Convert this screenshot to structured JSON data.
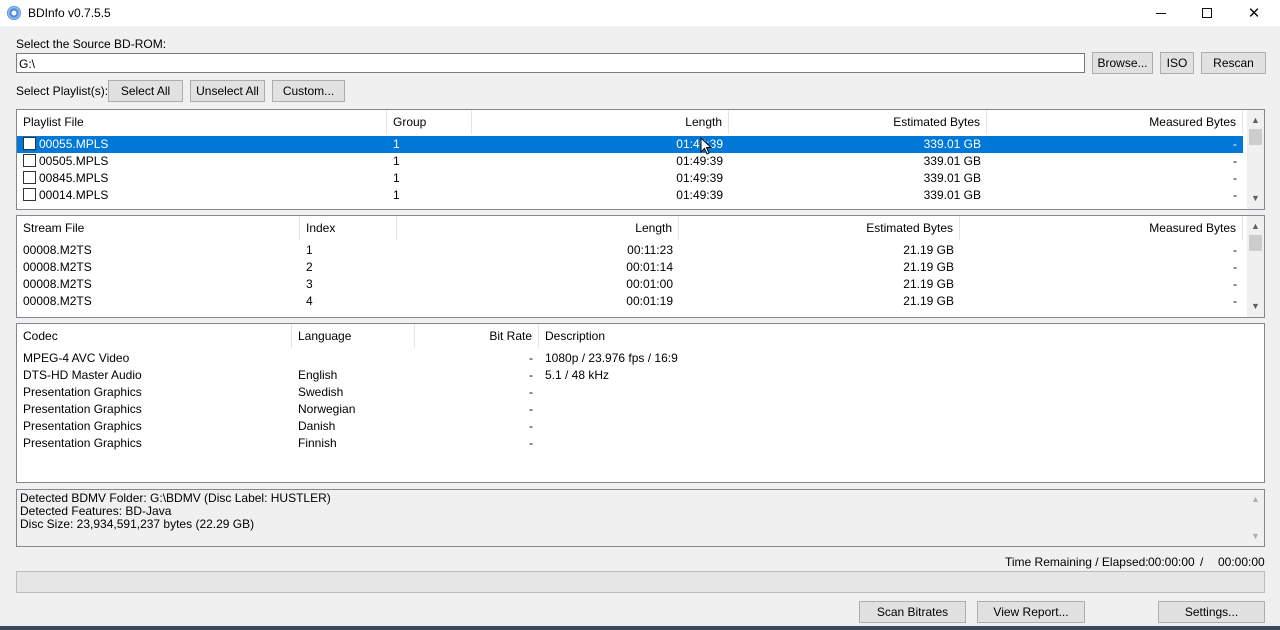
{
  "window": {
    "title": "BDInfo v0.7.5.5"
  },
  "source": {
    "label": "Select the Source BD-ROM:",
    "path": "G:\\",
    "browse": "Browse...",
    "iso": "ISO",
    "rescan": "Rescan"
  },
  "playlist_controls": {
    "label": "Select Playlist(s):",
    "select_all": "Select All",
    "unselect_all": "Unselect All",
    "custom": "Custom..."
  },
  "playlists": {
    "columns": [
      "Playlist File",
      "Group",
      "Length",
      "Estimated Bytes",
      "Measured Bytes"
    ],
    "rows": [
      {
        "file": "00055.MPLS",
        "group": "1",
        "length": "01:49:39",
        "est": "339.01 GB",
        "meas": "-"
      },
      {
        "file": "00505.MPLS",
        "group": "1",
        "length": "01:49:39",
        "est": "339.01 GB",
        "meas": "-"
      },
      {
        "file": "00845.MPLS",
        "group": "1",
        "length": "01:49:39",
        "est": "339.01 GB",
        "meas": "-"
      },
      {
        "file": "00014.MPLS",
        "group": "1",
        "length": "01:49:39",
        "est": "339.01 GB",
        "meas": "-"
      }
    ]
  },
  "streams": {
    "columns": [
      "Stream File",
      "Index",
      "Length",
      "Estimated Bytes",
      "Measured Bytes"
    ],
    "rows": [
      {
        "file": "00008.M2TS",
        "index": "1",
        "length": "00:11:23",
        "est": "21.19 GB",
        "meas": "-"
      },
      {
        "file": "00008.M2TS",
        "index": "2",
        "length": "00:01:14",
        "est": "21.19 GB",
        "meas": "-"
      },
      {
        "file": "00008.M2TS",
        "index": "3",
        "length": "00:01:00",
        "est": "21.19 GB",
        "meas": "-"
      },
      {
        "file": "00008.M2TS",
        "index": "4",
        "length": "00:01:19",
        "est": "21.19 GB",
        "meas": "-"
      }
    ]
  },
  "codecs": {
    "columns": [
      "Codec",
      "Language",
      "Bit Rate",
      "Description"
    ],
    "rows": [
      {
        "codec": "MPEG-4 AVC Video",
        "lang": "",
        "bitrate": "-",
        "desc": "1080p / 23.976 fps / 16:9"
      },
      {
        "codec": "DTS-HD Master Audio",
        "lang": "English",
        "bitrate": "-",
        "desc": "5.1 / 48 kHz"
      },
      {
        "codec": "Presentation Graphics",
        "lang": "Swedish",
        "bitrate": "-",
        "desc": ""
      },
      {
        "codec": "Presentation Graphics",
        "lang": "Norwegian",
        "bitrate": "-",
        "desc": ""
      },
      {
        "codec": "Presentation Graphics",
        "lang": "Danish",
        "bitrate": "-",
        "desc": ""
      },
      {
        "codec": "Presentation Graphics",
        "lang": "Finnish",
        "bitrate": "-",
        "desc": ""
      }
    ]
  },
  "log": [
    "Detected BDMV Folder: G:\\BDMV (Disc Label: HUSTLER)",
    "Detected Features: BD-Java",
    "Disc Size: 23,934,591,237 bytes (22.29 GB)"
  ],
  "timing": {
    "label": "Time Remaining / Elapsed:",
    "remaining": "00:00:00",
    "separator": "/",
    "elapsed": "00:00:00"
  },
  "progress": {
    "value": 0
  },
  "actions": {
    "scan": "Scan Bitrates",
    "report": "View Report...",
    "settings": "Settings..."
  },
  "colors": {
    "selection": "#0078d7",
    "background": "#f0f0f0"
  }
}
